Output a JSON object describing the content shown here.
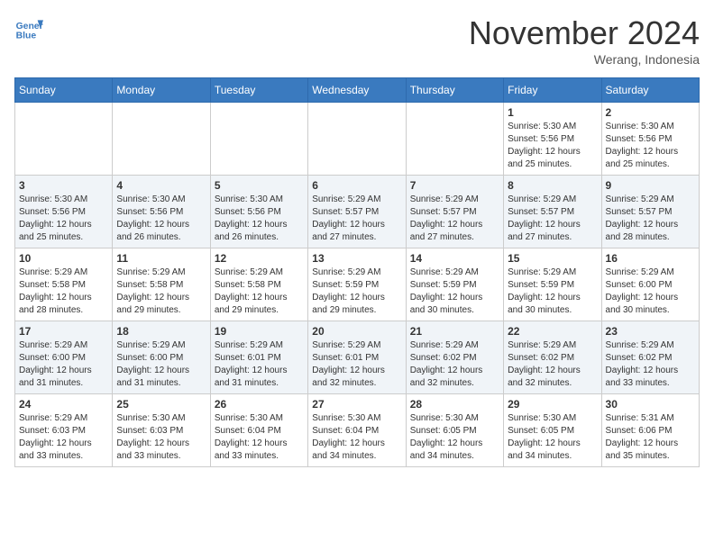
{
  "header": {
    "logo_line1": "General",
    "logo_line2": "Blue",
    "month": "November 2024",
    "location": "Werang, Indonesia"
  },
  "weekdays": [
    "Sunday",
    "Monday",
    "Tuesday",
    "Wednesday",
    "Thursday",
    "Friday",
    "Saturday"
  ],
  "weeks": [
    [
      {
        "day": "",
        "info": ""
      },
      {
        "day": "",
        "info": ""
      },
      {
        "day": "",
        "info": ""
      },
      {
        "day": "",
        "info": ""
      },
      {
        "day": "",
        "info": ""
      },
      {
        "day": "1",
        "info": "Sunrise: 5:30 AM\nSunset: 5:56 PM\nDaylight: 12 hours\nand 25 minutes."
      },
      {
        "day": "2",
        "info": "Sunrise: 5:30 AM\nSunset: 5:56 PM\nDaylight: 12 hours\nand 25 minutes."
      }
    ],
    [
      {
        "day": "3",
        "info": "Sunrise: 5:30 AM\nSunset: 5:56 PM\nDaylight: 12 hours\nand 25 minutes."
      },
      {
        "day": "4",
        "info": "Sunrise: 5:30 AM\nSunset: 5:56 PM\nDaylight: 12 hours\nand 26 minutes."
      },
      {
        "day": "5",
        "info": "Sunrise: 5:30 AM\nSunset: 5:56 PM\nDaylight: 12 hours\nand 26 minutes."
      },
      {
        "day": "6",
        "info": "Sunrise: 5:29 AM\nSunset: 5:57 PM\nDaylight: 12 hours\nand 27 minutes."
      },
      {
        "day": "7",
        "info": "Sunrise: 5:29 AM\nSunset: 5:57 PM\nDaylight: 12 hours\nand 27 minutes."
      },
      {
        "day": "8",
        "info": "Sunrise: 5:29 AM\nSunset: 5:57 PM\nDaylight: 12 hours\nand 27 minutes."
      },
      {
        "day": "9",
        "info": "Sunrise: 5:29 AM\nSunset: 5:57 PM\nDaylight: 12 hours\nand 28 minutes."
      }
    ],
    [
      {
        "day": "10",
        "info": "Sunrise: 5:29 AM\nSunset: 5:58 PM\nDaylight: 12 hours\nand 28 minutes."
      },
      {
        "day": "11",
        "info": "Sunrise: 5:29 AM\nSunset: 5:58 PM\nDaylight: 12 hours\nand 29 minutes."
      },
      {
        "day": "12",
        "info": "Sunrise: 5:29 AM\nSunset: 5:58 PM\nDaylight: 12 hours\nand 29 minutes."
      },
      {
        "day": "13",
        "info": "Sunrise: 5:29 AM\nSunset: 5:59 PM\nDaylight: 12 hours\nand 29 minutes."
      },
      {
        "day": "14",
        "info": "Sunrise: 5:29 AM\nSunset: 5:59 PM\nDaylight: 12 hours\nand 30 minutes."
      },
      {
        "day": "15",
        "info": "Sunrise: 5:29 AM\nSunset: 5:59 PM\nDaylight: 12 hours\nand 30 minutes."
      },
      {
        "day": "16",
        "info": "Sunrise: 5:29 AM\nSunset: 6:00 PM\nDaylight: 12 hours\nand 30 minutes."
      }
    ],
    [
      {
        "day": "17",
        "info": "Sunrise: 5:29 AM\nSunset: 6:00 PM\nDaylight: 12 hours\nand 31 minutes."
      },
      {
        "day": "18",
        "info": "Sunrise: 5:29 AM\nSunset: 6:00 PM\nDaylight: 12 hours\nand 31 minutes."
      },
      {
        "day": "19",
        "info": "Sunrise: 5:29 AM\nSunset: 6:01 PM\nDaylight: 12 hours\nand 31 minutes."
      },
      {
        "day": "20",
        "info": "Sunrise: 5:29 AM\nSunset: 6:01 PM\nDaylight: 12 hours\nand 32 minutes."
      },
      {
        "day": "21",
        "info": "Sunrise: 5:29 AM\nSunset: 6:02 PM\nDaylight: 12 hours\nand 32 minutes."
      },
      {
        "day": "22",
        "info": "Sunrise: 5:29 AM\nSunset: 6:02 PM\nDaylight: 12 hours\nand 32 minutes."
      },
      {
        "day": "23",
        "info": "Sunrise: 5:29 AM\nSunset: 6:02 PM\nDaylight: 12 hours\nand 33 minutes."
      }
    ],
    [
      {
        "day": "24",
        "info": "Sunrise: 5:29 AM\nSunset: 6:03 PM\nDaylight: 12 hours\nand 33 minutes."
      },
      {
        "day": "25",
        "info": "Sunrise: 5:30 AM\nSunset: 6:03 PM\nDaylight: 12 hours\nand 33 minutes."
      },
      {
        "day": "26",
        "info": "Sunrise: 5:30 AM\nSunset: 6:04 PM\nDaylight: 12 hours\nand 33 minutes."
      },
      {
        "day": "27",
        "info": "Sunrise: 5:30 AM\nSunset: 6:04 PM\nDaylight: 12 hours\nand 34 minutes."
      },
      {
        "day": "28",
        "info": "Sunrise: 5:30 AM\nSunset: 6:05 PM\nDaylight: 12 hours\nand 34 minutes."
      },
      {
        "day": "29",
        "info": "Sunrise: 5:30 AM\nSunset: 6:05 PM\nDaylight: 12 hours\nand 34 minutes."
      },
      {
        "day": "30",
        "info": "Sunrise: 5:31 AM\nSunset: 6:06 PM\nDaylight: 12 hours\nand 35 minutes."
      }
    ]
  ]
}
